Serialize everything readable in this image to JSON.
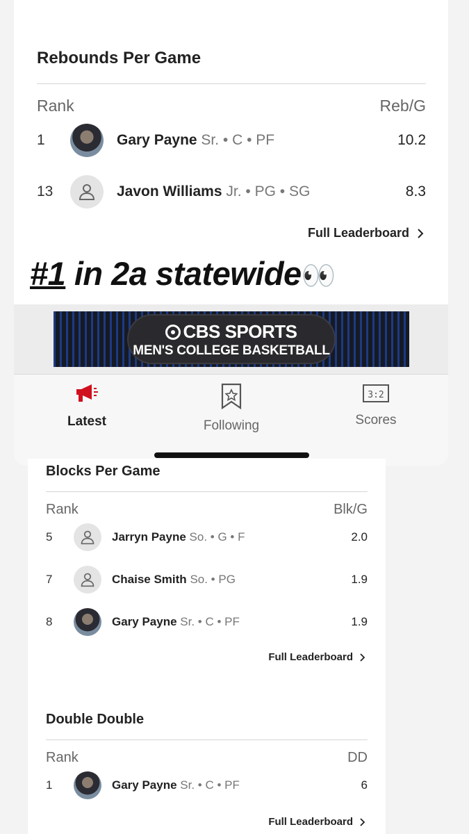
{
  "rebounds": {
    "title": "Rebounds Per Game",
    "col_rank": "Rank",
    "col_stat": "Reb/G",
    "rows": [
      {
        "rank": "1",
        "name": "Gary Payne",
        "meta": "Sr. • C • PF",
        "value": "10.2"
      },
      {
        "rank": "13",
        "name": "Javon Williams",
        "meta": "Jr. • PG • SG",
        "value": "8.3"
      }
    ],
    "full_link": "Full Leaderboard"
  },
  "caption": {
    "hashtag": "#1",
    "text": " in 2a statewide",
    "emoji": "👀"
  },
  "ad": {
    "brand": "CBS SPORTS",
    "subtitle": "MEN'S COLLEGE BASKETBALL"
  },
  "tabs": [
    {
      "label": "Latest",
      "icon": "megaphone-icon",
      "active": true
    },
    {
      "label": "Following",
      "icon": "bookmark-star-icon",
      "active": false
    },
    {
      "label": "Scores",
      "icon": "scoreboard-icon",
      "active": false
    }
  ],
  "blocks": {
    "title": "Blocks Per Game",
    "col_rank": "Rank",
    "col_stat": "Blk/G",
    "rows": [
      {
        "rank": "5",
        "name": "Jarryn Payne",
        "meta": "So. • G • F",
        "value": "2.0"
      },
      {
        "rank": "7",
        "name": "Chaise Smith",
        "meta": "So. • PG",
        "value": "1.9"
      },
      {
        "rank": "8",
        "name": "Gary Payne",
        "meta": "Sr. • C • PF",
        "value": "1.9"
      }
    ],
    "full_link": "Full Leaderboard"
  },
  "double_double": {
    "title": "Double Double",
    "col_rank": "Rank",
    "col_stat": "DD",
    "rows": [
      {
        "rank": "1",
        "name": "Gary Payne",
        "meta": "Sr. • C • PF",
        "value": "6"
      }
    ],
    "full_link": "Full Leaderboard"
  },
  "colors": {
    "accent": "#d0101e",
    "text": "#222222",
    "muted": "#777777"
  }
}
